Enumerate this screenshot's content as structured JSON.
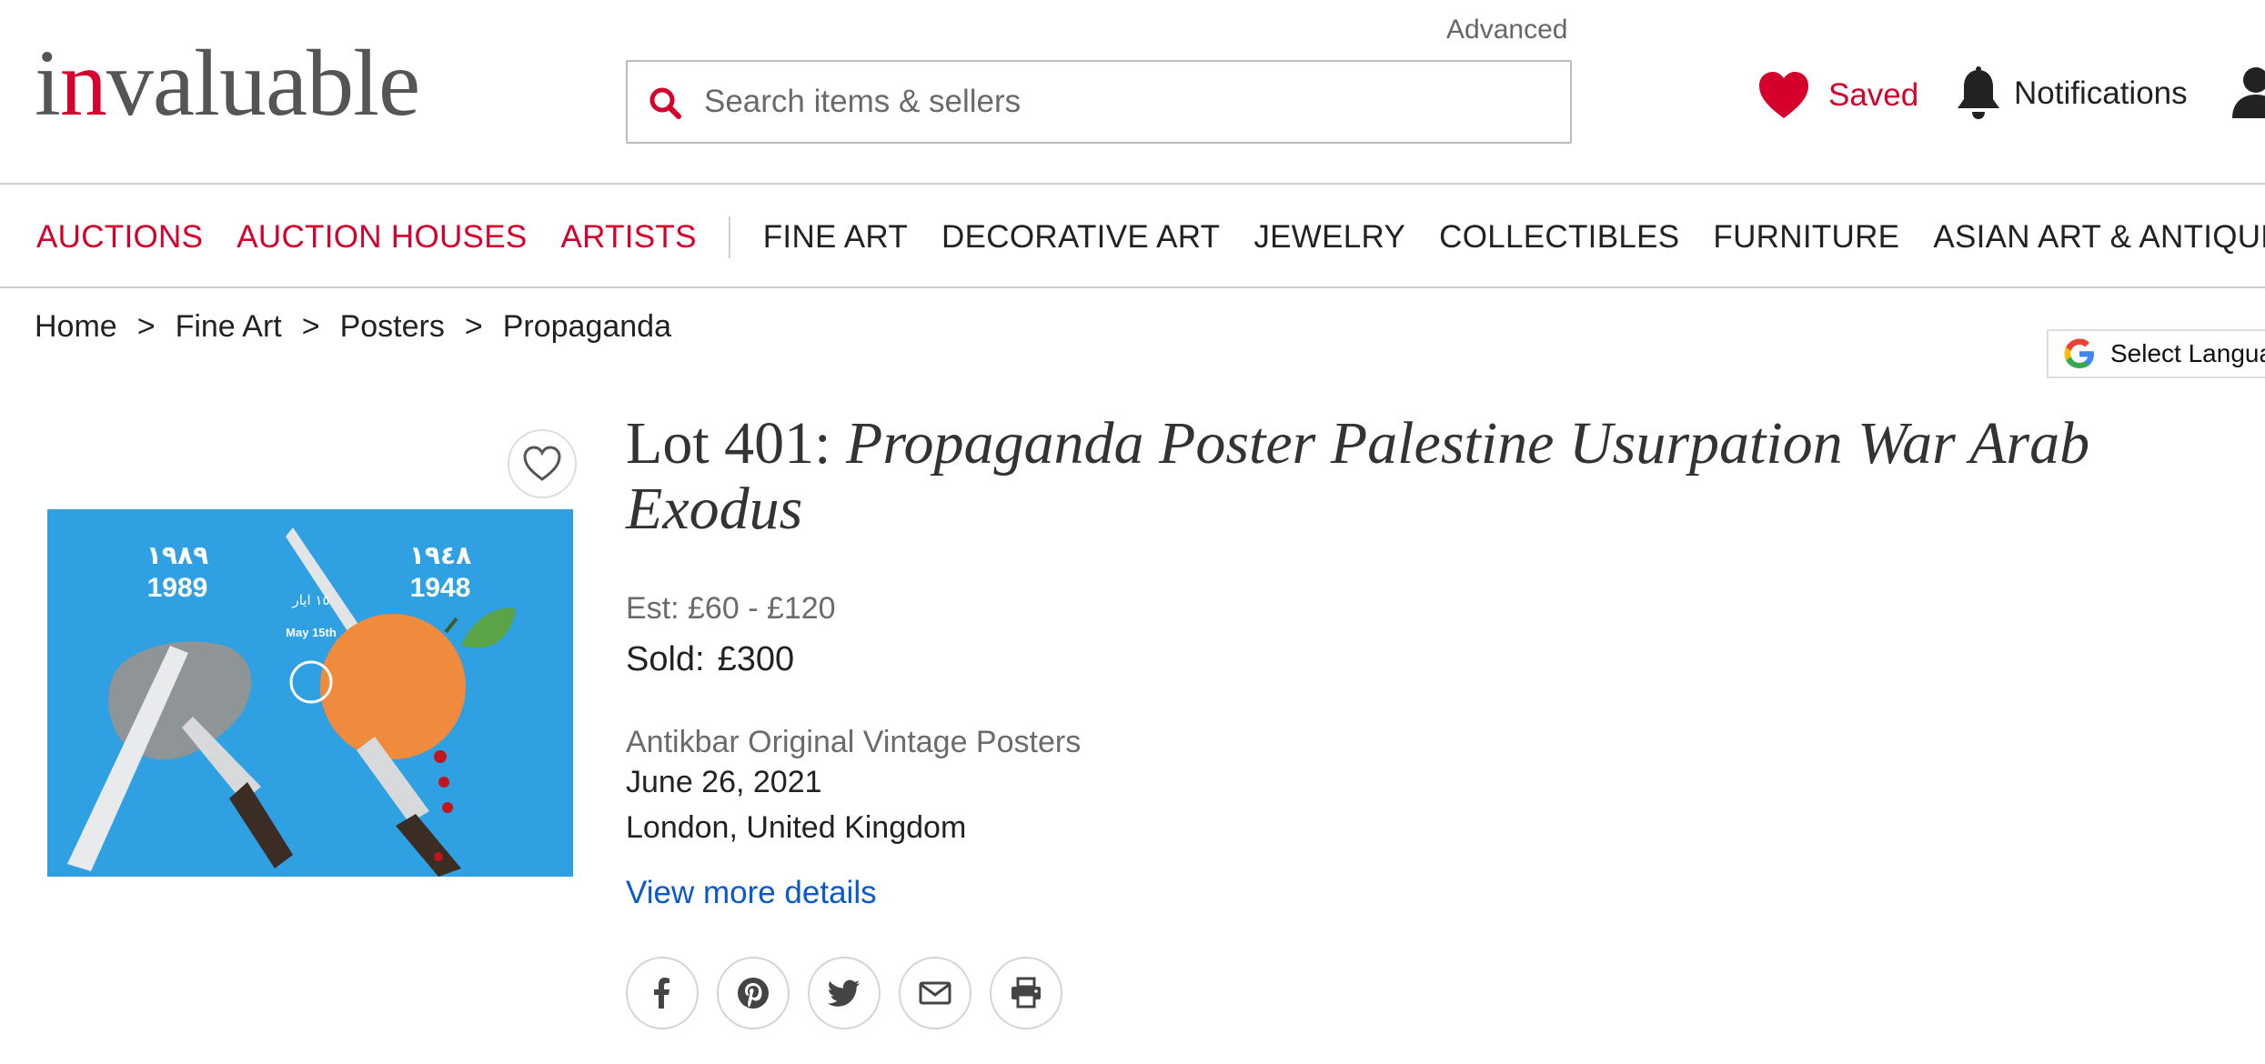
{
  "header": {
    "logo": {
      "prefix": "i",
      "accent": "n",
      "rest": "valuable"
    },
    "advanced_label": "Advanced",
    "search": {
      "placeholder": "Search items & sellers",
      "value": ""
    },
    "saved_label": "Saved",
    "notifications_label": "Notifications",
    "icons": [
      "search-icon",
      "heart-icon",
      "bell-icon",
      "user-icon"
    ]
  },
  "nav": {
    "primary": [
      "AUCTIONS",
      "AUCTION HOUSES",
      "ARTISTS"
    ],
    "categories": [
      "FINE ART",
      "DECORATIVE ART",
      "JEWELRY",
      "COLLECTIBLES",
      "FURNITURE",
      "ASIAN ART & ANTIQUE"
    ]
  },
  "breadcrumb": {
    "items": [
      "Home",
      "Fine Art",
      "Posters",
      "Propaganda"
    ],
    "separator": ">"
  },
  "translate": {
    "label": "Select Langua"
  },
  "lot": {
    "number_label": "Lot 401:",
    "title": "Propaganda Poster Palestine Usurpation War Arab Exodus",
    "estimate": "Est: £60 - £120",
    "sold_label": "Sold:",
    "sold_price": "£300",
    "auction_house": "Antikbar Original Vintage Posters",
    "date": "June 26, 2021",
    "location": "London, United Kingdom",
    "view_more_label": "View more details"
  },
  "poster": {
    "year_left_arabic": "١٩٨٩",
    "year_left": "1989",
    "year_right_arabic": "١٩٤٨",
    "year_right": "1948",
    "date_arabic": "١٥ ايار",
    "date_english": "May 15th"
  },
  "share": [
    "facebook-icon",
    "pinterest-icon",
    "twitter-icon",
    "email-icon",
    "print-icon"
  ],
  "colors": {
    "brand_red": "#d5002b",
    "link_blue": "#0a58d0",
    "poster_blue": "#2fa0e2",
    "orange": "#f08a3c"
  }
}
